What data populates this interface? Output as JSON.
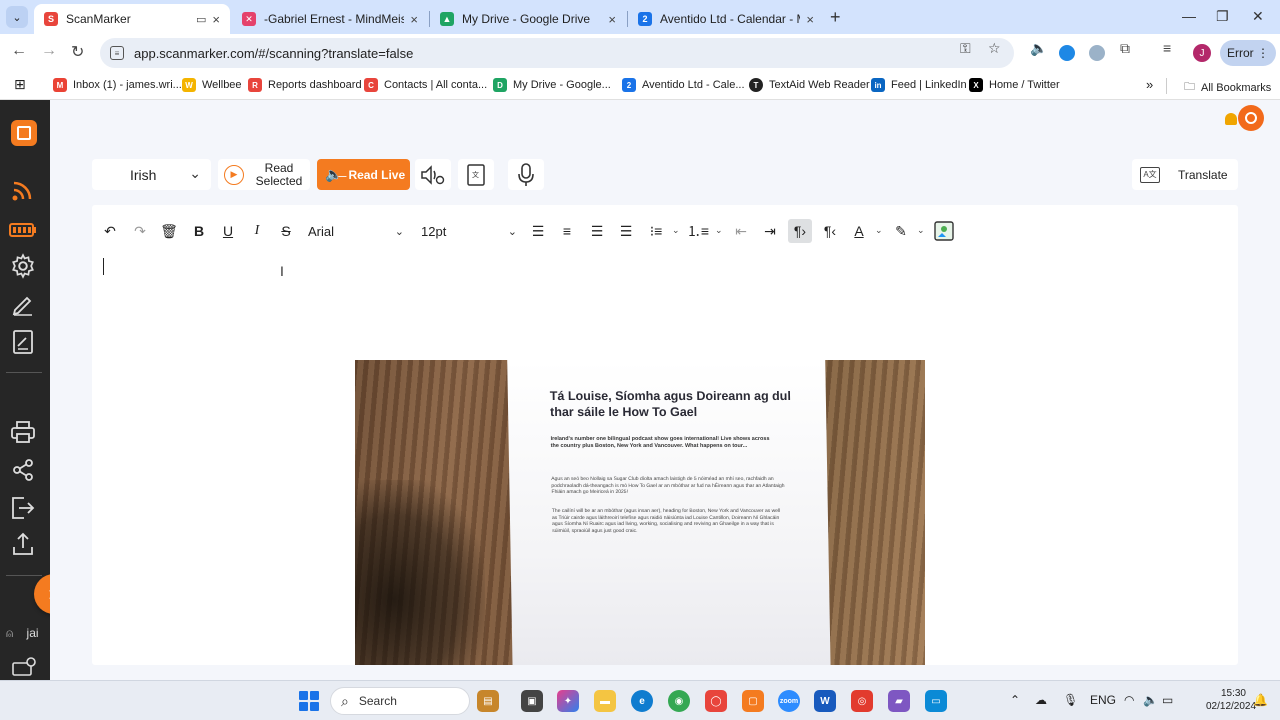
{
  "browser": {
    "tabs": [
      {
        "title": "ScanMarker",
        "color": "#e8453c",
        "active": true
      },
      {
        "title": "-Gabriel Ernest - MindMeister M",
        "color": "#e5426b",
        "active": false
      },
      {
        "title": "My Drive - Google Drive",
        "color": "#1fa463",
        "active": false
      },
      {
        "title": "Aventido Ltd - Calendar - Mond",
        "color": "#1a73e8",
        "active": false
      }
    ],
    "url": "app.scanmarker.com/#/scanning?translate=false",
    "profile_initial": "J",
    "error_label": "Error",
    "bookmarks": [
      {
        "label": "Inbox (1) - james.wri...",
        "color": "#ea4335",
        "glyph": "M"
      },
      {
        "label": "Wellbee",
        "color": "#f4b400",
        "glyph": "W"
      },
      {
        "label": "Reports dashboard",
        "color": "#e8453c",
        "glyph": "R"
      },
      {
        "label": "Contacts | All conta...",
        "color": "#e8453c",
        "glyph": "C"
      },
      {
        "label": "My Drive - Google...",
        "color": "#1fa463",
        "glyph": "D"
      },
      {
        "label": "Aventido Ltd - Cale...",
        "color": "#1a73e8",
        "glyph": "2"
      },
      {
        "label": "TextAid Web Reader",
        "color": "#222222",
        "glyph": "T"
      },
      {
        "label": "Feed | LinkedIn",
        "color": "#0a66c2",
        "glyph": "in"
      },
      {
        "label": "Home / Twitter",
        "color": "#000000",
        "glyph": "X"
      }
    ],
    "all_bookmarks": "All Bookmarks"
  },
  "sidebar": {
    "user_label": "jai"
  },
  "app": {
    "language": "Irish",
    "read_selected_line1": "Read",
    "read_selected_line2": "Selected",
    "read_live": "Read Live",
    "translate": "Translate",
    "accent_color": "#f47b20"
  },
  "editor": {
    "font_family": "Arial",
    "font_size": "12pt"
  },
  "document_photo": {
    "heading": "Tá Louise, Síomha agus Doireann ag dul thar sáile le How To Gael",
    "subheading": "Ireland's number one bilingual podcast show goes international! Live shows across the country plus Boston, New York and Vancouver. What happens on tour...",
    "para1": "Agus an seó beo Nollaig sa Sugar Club díolta amach laistigh de 5 nóiméad an mhí seo, rachfaidh an podchraoladh dá-theangach is mó How To Gael ar an mbóthar ar fud na hÉireann agus thar an Atlantaigh Fhiáin amach go Meiriceá in 2025!",
    "para2": "The cailíní will be ar an mbóthar (agus insan aer), heading for Boston, New York and Vancouver as well as Triúir cairde agus láithreoirí telefíse agus raidió náisiúnta iad Louise Cantillon, Doireann Ní Ghlacáin agus Síomha Ní Ruairc agus iad living, working, socialising and reviving an Ghaeilge in a way that is súimiúil, spraoiúil agus just good craic."
  },
  "taskbar": {
    "search_label": "Search",
    "lang": "ENG",
    "time": "15:30",
    "date": "02/12/2024"
  }
}
